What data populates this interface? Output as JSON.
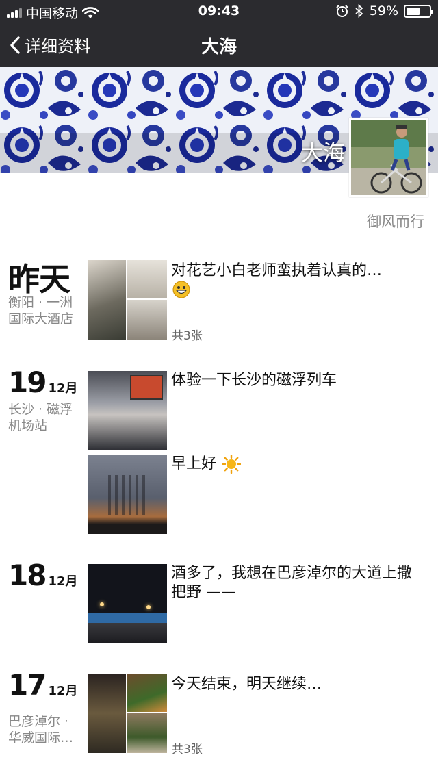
{
  "status_bar": {
    "carrier": "中国移动",
    "time": "09:43",
    "battery": "59%",
    "battery_level": 0.59
  },
  "nav": {
    "back_label": "详细资料",
    "title": "大海"
  },
  "profile": {
    "name": "大海",
    "signature": "御风而行"
  },
  "entries": [
    {
      "day": "昨天",
      "location": "衡阳 · 一洲国际大酒店",
      "text": "对花艺小白老师蛮执着认真的…",
      "count": "共3张"
    },
    {
      "day": "19",
      "month": "12月",
      "location": "长沙 · 磁浮机场站",
      "text": "体验一下长沙的磁浮列车"
    },
    {
      "text": "早上好"
    },
    {
      "day": "18",
      "month": "12月",
      "text": "酒多了，我想在巴彦淖尔的大道上撒把野 ——"
    },
    {
      "day": "17",
      "month": "12月",
      "location": "巴彦淖尔 · 华威国际…",
      "text": "今天结束，明天继续…",
      "count": "共3张"
    }
  ]
}
